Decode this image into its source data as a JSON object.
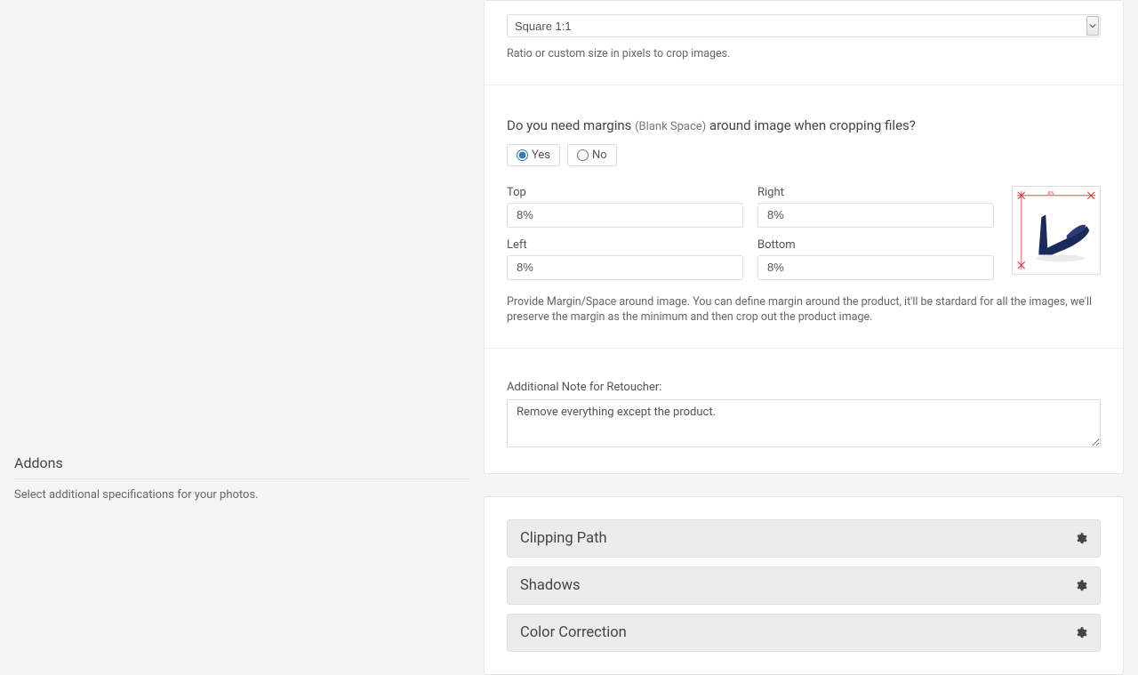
{
  "crop": {
    "ratio_selected": "Square 1:1",
    "ratio_help": "Ratio or custom size in pixels to crop images."
  },
  "margins": {
    "question_pre": "Do you need margins ",
    "question_sub": "(Blank Space)",
    "question_post": " around image when cropping files?",
    "yes_label": "Yes",
    "no_label": "No",
    "selected": "yes",
    "fields": {
      "top_label": "Top",
      "top_value": "8%",
      "right_label": "Right",
      "right_value": "8%",
      "left_label": "Left",
      "left_value": "8%",
      "bottom_label": "Bottom",
      "bottom_value": "8%"
    },
    "help": "Provide Margin/Space around image. You can define margin around the product, it'll be stardard for all the images, we'll preserve the margin as the minimum and then crop out the product image."
  },
  "note": {
    "label": "Additional Note for Retoucher:",
    "value": "Remove everything except the product."
  },
  "addons": {
    "title": "Addons",
    "subtitle": "Select additional specifications for your photos.",
    "items": {
      "clipping": "Clipping Path",
      "shadows": "Shadows",
      "color": "Color Correction"
    }
  }
}
